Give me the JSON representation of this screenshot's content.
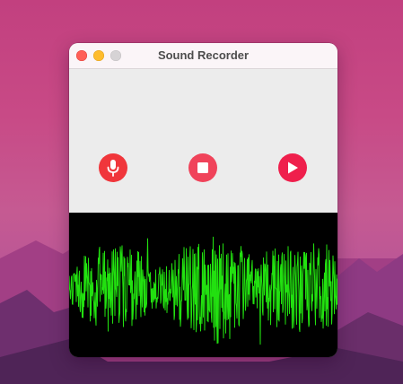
{
  "window": {
    "title": "Sound Recorder"
  },
  "controls": {
    "record_icon": "microphone-icon",
    "stop_icon": "stop-icon",
    "play_icon": "play-icon",
    "accent": "#f0363b"
  },
  "waveform": {
    "background": "#000000",
    "color": "#22e010"
  }
}
